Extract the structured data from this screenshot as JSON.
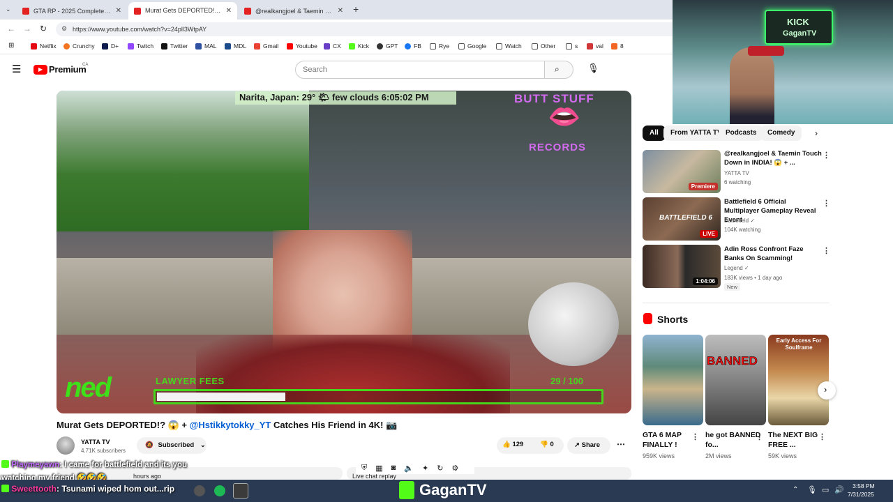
{
  "browser": {
    "tabs": [
      {
        "label": "GTA RP - 2025 Complete Begin"
      },
      {
        "label": "Murat Gets DEPORTED!? 😱 "
      },
      {
        "label": "@realkangjoel & Taemin Touch"
      }
    ],
    "new_tab": "+",
    "url": "https://www.youtube.com/watch?v=24pll3WtpAY",
    "bookmarks": [
      "Netflix",
      "Crunchy",
      "D+",
      "Twitch",
      "Twitter",
      "MAL",
      "MDL",
      "Gmail",
      "Youtube",
      "CX",
      "Kick",
      "GPT",
      "FB",
      "Rye",
      "Google",
      "Watch",
      "Other",
      "s",
      "val",
      "8"
    ]
  },
  "youtube": {
    "logo": "Premium",
    "region": "CA",
    "search_placeholder": "Search"
  },
  "video": {
    "overlay_weather": "Narita, Japan: 29° 🌤 few clouds 6:05:02 PM",
    "overlay_brand_top": "BUTT STUFF",
    "overlay_brand_bottom": "RECORDS",
    "overlay_logo": "ned",
    "overlay_bar_label": "LAWYER FEES",
    "overlay_bar_count": "29 / 100",
    "overlay_bar_progress": 0.29,
    "title_prefix": "Murat Gets DEPORTED!? 😱 + ",
    "title_link": "@Hstikkytokky_YT",
    "title_suffix": " Catches His Friend in 4K! 📷",
    "channel": "YATTA TV",
    "subscribers": "4.71K subscribers",
    "subscribed_label": "Subscribed",
    "likes": "129",
    "dislikes": "0",
    "share": "Share",
    "live_chat": "Live chat replay",
    "time_ago": "hours ago"
  },
  "sidebar": {
    "chips": [
      "All",
      "From YATTA TV",
      "Podcasts",
      "Comedy"
    ],
    "related": [
      {
        "title": "@realkangjoel & Taemin Touch Down in INDIA! 😱 + ...",
        "channel": "YATTA TV",
        "meta": "6 watching",
        "badge": "Premiere"
      },
      {
        "title": "Battlefield 6 Official Multiplayer Gameplay Reveal Event",
        "channel": "Battlefield ✓",
        "meta": "104K watching",
        "badge": "LIVE",
        "thumb_text": "BATTLEFIELD 6"
      },
      {
        "title": "Adin Ross Confront Faze Banks On Scamming!",
        "channel": "Legend ✓",
        "meta": "183K views • 1 day ago",
        "badge": "1:04:06",
        "tag": "New"
      }
    ],
    "shorts_heading": "Shorts",
    "shorts": [
      {
        "title": "GTA 6 MAP FINALLY !",
        "views": "959K views"
      },
      {
        "title": "he got BANNED fo...",
        "views": "2M views",
        "thumb_text": "BANNED"
      },
      {
        "title": "The NEXT BIG FREE ...",
        "views": "59K views",
        "thumb_text": "Early Access For Soulframe"
      }
    ]
  },
  "webcam": {
    "sign_line1": "KICK",
    "sign_line2": "GaganTV"
  },
  "chat": {
    "msg1_user": "Playmeyawn",
    "msg1_text": ": I came for battlefield and its you watching my friend 🤣🤣🤣",
    "msg2_user": "Sweettooth",
    "msg2_text": ": Tsunami wiped hom out...rip"
  },
  "taskbar": {
    "brand": "GaganTV",
    "time": "3:58 PM",
    "date": "7/31/2025"
  }
}
